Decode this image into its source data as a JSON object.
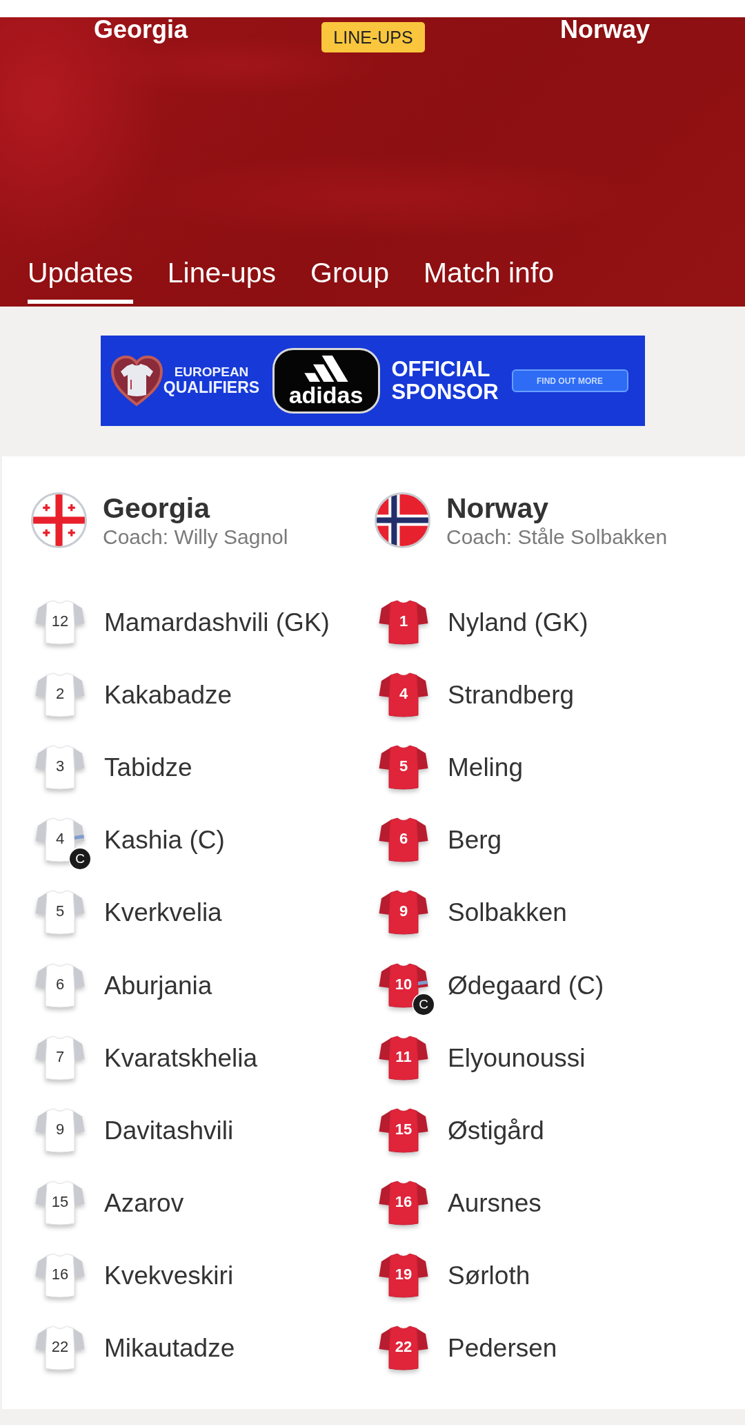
{
  "header": {
    "home_team": "Georgia",
    "badge": "LINE-UPS",
    "away_team": "Norway"
  },
  "tabs": [
    {
      "label": "Updates",
      "selected": true
    },
    {
      "label": "Line-ups",
      "selected": false
    },
    {
      "label": "Group",
      "selected": false
    },
    {
      "label": "Match info",
      "selected": false
    }
  ],
  "ad": {
    "emblem_lines": [
      "EUROPEAN",
      "QUALIFIERS"
    ],
    "logo_text": "adidas",
    "headline_lines": [
      "OFFICIAL",
      "SPONSOR"
    ],
    "button": "FIND OUT MORE"
  },
  "teams": [
    {
      "name": "Georgia",
      "coach": "Coach: Willy Sagnol",
      "players": [
        {
          "number": "12",
          "name": "Mamardashvili (GK)",
          "captain": false
        },
        {
          "number": "2",
          "name": "Kakabadze",
          "captain": false
        },
        {
          "number": "3",
          "name": "Tabidze",
          "captain": false
        },
        {
          "number": "4",
          "name": "Kashia (C)",
          "captain": true,
          "captain_badge": "C"
        },
        {
          "number": "5",
          "name": "Kverkvelia",
          "captain": false
        },
        {
          "number": "6",
          "name": "Aburjania",
          "captain": false
        },
        {
          "number": "7",
          "name": "Kvaratskhelia",
          "captain": false
        },
        {
          "number": "9",
          "name": "Davitashvili",
          "captain": false
        },
        {
          "number": "15",
          "name": "Azarov",
          "captain": false
        },
        {
          "number": "16",
          "name": "Kvekveskiri",
          "captain": false
        },
        {
          "number": "22",
          "name": "Mikautadze",
          "captain": false
        }
      ]
    },
    {
      "name": "Norway",
      "coach": "Coach: Ståle Solbakken",
      "players": [
        {
          "number": "1",
          "name": "Nyland (GK)",
          "captain": false
        },
        {
          "number": "4",
          "name": "Strandberg",
          "captain": false
        },
        {
          "number": "5",
          "name": "Meling",
          "captain": false
        },
        {
          "number": "6",
          "name": "Berg",
          "captain": false
        },
        {
          "number": "9",
          "name": "Solbakken",
          "captain": false
        },
        {
          "number": "10",
          "name": "Ødegaard (C)",
          "captain": true,
          "captain_badge": "C"
        },
        {
          "number": "11",
          "name": "Elyounoussi",
          "captain": false
        },
        {
          "number": "15",
          "name": "Østigård",
          "captain": false
        },
        {
          "number": "16",
          "name": "Aursnes",
          "captain": false
        },
        {
          "number": "19",
          "name": "Sørloth",
          "captain": false
        },
        {
          "number": "22",
          "name": "Pedersen",
          "captain": false
        }
      ]
    }
  ]
}
